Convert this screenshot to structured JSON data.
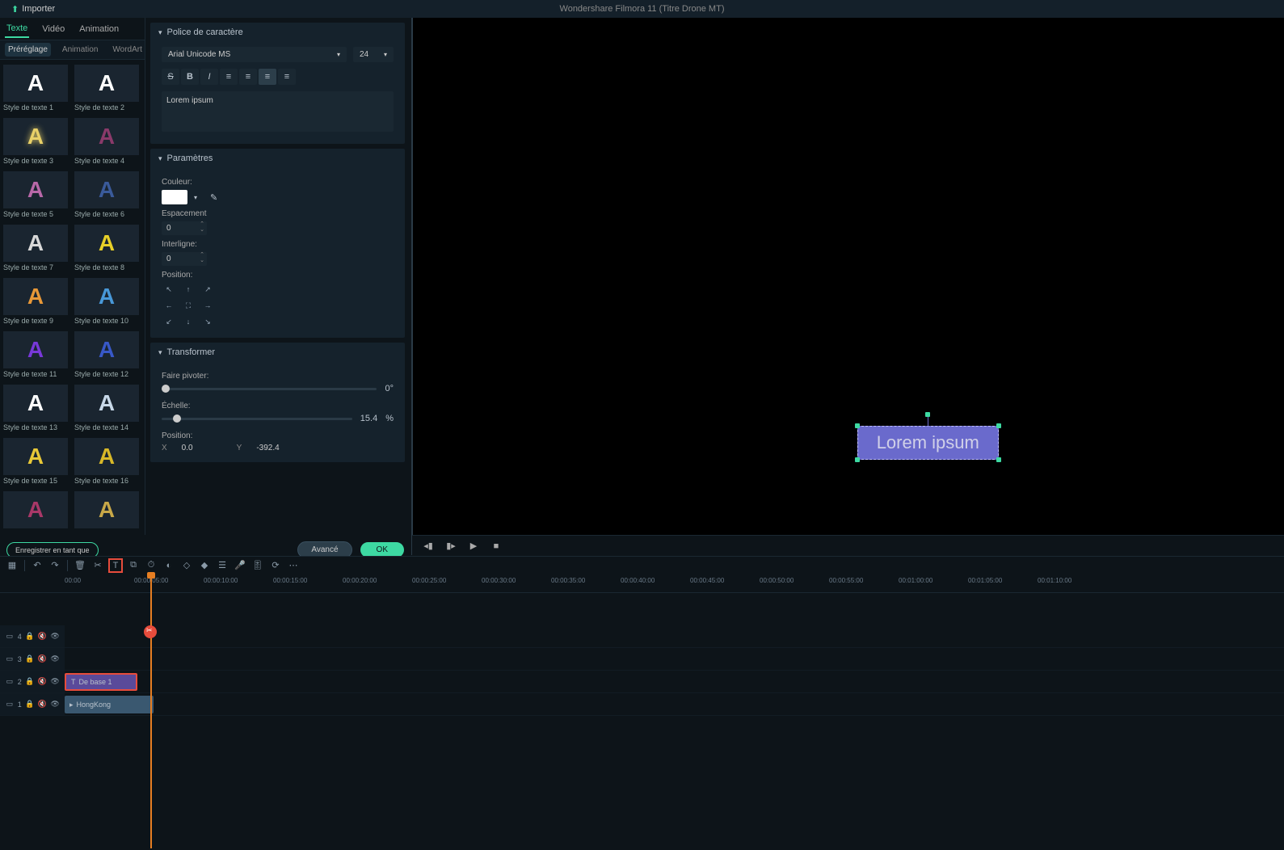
{
  "header": {
    "import_label": "Importer",
    "app_title": "Wondershare Filmora 11 (Titre Drone MT)"
  },
  "tabs1": {
    "texte": "Texte",
    "video": "Vidéo",
    "animation": "Animation"
  },
  "tabs2": {
    "prereglage": "Préréglage",
    "animation": "Animation",
    "wordart": "WordArt"
  },
  "presets": [
    {
      "label": "Style de texte 1",
      "letter": "A",
      "color": "#ffffff",
      "glow": "none"
    },
    {
      "label": "Style de texte 2",
      "letter": "A",
      "color": "#ffffff",
      "glow": "none"
    },
    {
      "label": "Style de texte 3",
      "letter": "A",
      "color": "#e8d068",
      "glow": "#e8d068"
    },
    {
      "label": "Style de texte 4",
      "letter": "A",
      "color": "#8a3a6a",
      "glow": "none"
    },
    {
      "label": "Style de texte 5",
      "letter": "A",
      "color": "#b868a8",
      "glow": "none"
    },
    {
      "label": "Style de texte 6",
      "letter": "A",
      "color": "#3a5a9a",
      "glow": "none"
    },
    {
      "label": "Style de texte 7",
      "letter": "A",
      "color": "#d8d8d8",
      "glow": "none"
    },
    {
      "label": "Style de texte 8",
      "letter": "A",
      "color": "#e8d028",
      "glow": "none"
    },
    {
      "label": "Style de texte 9",
      "letter": "A",
      "color": "#e89838",
      "glow": "none"
    },
    {
      "label": "Style de texte 10",
      "letter": "A",
      "color": "#4898d8",
      "glow": "none"
    },
    {
      "label": "Style de texte 11",
      "letter": "A",
      "color": "#7838d8",
      "glow": "none"
    },
    {
      "label": "Style de texte 12",
      "letter": "A",
      "color": "#3858c8",
      "glow": "none"
    },
    {
      "label": "Style de texte 13",
      "letter": "A",
      "color": "#ffffff",
      "glow": "none"
    },
    {
      "label": "Style de texte 14",
      "letter": "A",
      "color": "#c8d8e8",
      "glow": "none"
    },
    {
      "label": "Style de texte 15",
      "letter": "A",
      "color": "#e8c838",
      "glow": "none"
    },
    {
      "label": "Style de texte 16",
      "letter": "A",
      "color": "#d8b828",
      "glow": "none"
    },
    {
      "label": "",
      "letter": "A",
      "color": "#a83868",
      "glow": "none"
    },
    {
      "label": "",
      "letter": "A",
      "color": "#c8a848",
      "glow": "none"
    }
  ],
  "police": {
    "header": "Police de caractère",
    "font": "Arial Unicode MS",
    "size": "24",
    "text": "Lorem ipsum"
  },
  "params": {
    "header": "Paramètres",
    "couleur": "Couleur:",
    "espacement": "Espacement",
    "espacement_val": "0",
    "interligne": "Interligne:",
    "interligne_val": "0",
    "position": "Position:"
  },
  "transform": {
    "header": "Transformer",
    "rotate": "Faire pivoter:",
    "rotate_val": "0°",
    "scale": "Échelle:",
    "scale_val": "15.4",
    "scale_unit": "%",
    "position": "Position:",
    "x_label": "X",
    "x_val": "0.0",
    "y_label": "Y",
    "y_val": "-392.4"
  },
  "buttons": {
    "save_as": "Enregistrer en tant que",
    "advanced": "Avancé",
    "ok": "OK"
  },
  "preview": {
    "text": "Lorem ipsum"
  },
  "ruler_ticks": [
    "00:00",
    "00:00:05:00",
    "00:00:10:00",
    "00:00:15:00",
    "00:00:20:00",
    "00:00:25:00",
    "00:00:30:00",
    "00:00:35:00",
    "00:00:40:00",
    "00:00:45:00",
    "00:00:50:00",
    "00:00:55:00",
    "00:01:00:00",
    "00:01:05:00",
    "00:01:10:00"
  ],
  "tracks": {
    "t4": "4",
    "t3": "3",
    "t2": "2",
    "t1": "1",
    "clip_title": "De base 1",
    "clip_video": "HongKong"
  }
}
